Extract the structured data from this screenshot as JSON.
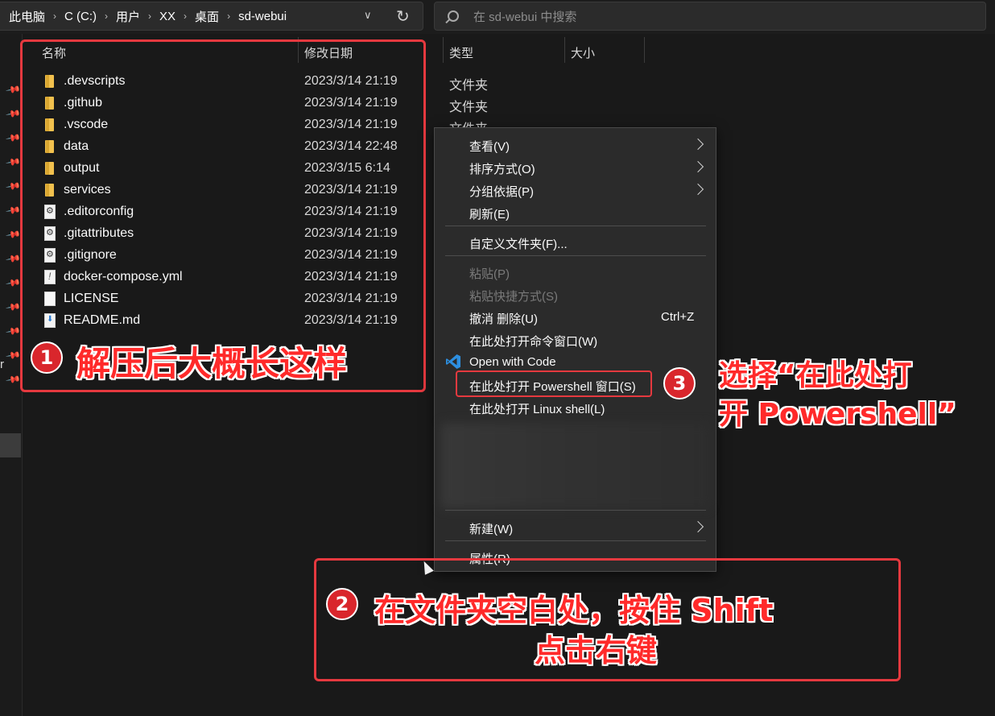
{
  "address_bar": {
    "crumbs": [
      "此电脑",
      "C (C:)",
      "用户",
      "XX",
      "桌面",
      "sd-webui"
    ],
    "separator": "›",
    "dropdown": "∨",
    "refresh": "↻"
  },
  "search": {
    "placeholder": "在 sd-webui 中搜索"
  },
  "columns": {
    "name": "名称",
    "date": "修改日期",
    "type": "类型",
    "size": "大小"
  },
  "nav_fragment": "r",
  "files": [
    {
      "name": ".devscripts",
      "date": "2023/3/14 21:19",
      "type": "文件夹",
      "icon": "folder-icon"
    },
    {
      "name": ".github",
      "date": "2023/3/14 21:19",
      "type": "文件夹",
      "icon": "folder-icon"
    },
    {
      "name": ".vscode",
      "date": "2023/3/14 21:19",
      "type": "文件夹",
      "icon": "folder-icon"
    },
    {
      "name": "data",
      "date": "2023/3/14 22:48",
      "type": "",
      "icon": "folder-icon"
    },
    {
      "name": "output",
      "date": "2023/3/15 6:14",
      "type": "",
      "icon": "folder-icon"
    },
    {
      "name": "services",
      "date": "2023/3/14 21:19",
      "type": "",
      "icon": "folder-icon"
    },
    {
      "name": ".editorconfig",
      "date": "2023/3/14 21:19",
      "type": "",
      "icon": "gear-file-icon"
    },
    {
      "name": ".gitattributes",
      "date": "2023/3/14 21:19",
      "type": "",
      "icon": "gear-file-icon"
    },
    {
      "name": ".gitignore",
      "date": "2023/3/14 21:19",
      "type": "",
      "icon": "gear-file-icon"
    },
    {
      "name": "docker-compose.yml",
      "date": "2023/3/14 21:19",
      "type": "",
      "icon": "yml-file-icon"
    },
    {
      "name": "LICENSE",
      "date": "2023/3/14 21:19",
      "type": "",
      "icon": "document-icon"
    },
    {
      "name": "README.md",
      "date": "2023/3/14 21:19",
      "type": "",
      "icon": "markdown-file-icon"
    }
  ],
  "context_menu": {
    "view": "查看(V)",
    "sort": "排序方式(O)",
    "group": "分组依据(P)",
    "refresh": "刷新(E)",
    "customize": "自定义文件夹(F)...",
    "paste": "粘贴(P)",
    "paste_shortcut": "粘贴快捷方式(S)",
    "undo_delete": "撤消 删除(U)",
    "undo_shortcut": "Ctrl+Z",
    "open_cmd": "在此处打开命令窗口(W)",
    "open_with_code": "Open with Code",
    "open_powershell": "在此处打开 Powershell 窗口(S)",
    "open_linux_shell": "在此处打开 Linux shell(L)",
    "new": "新建(W)",
    "properties": "属性(R)"
  },
  "annotations": {
    "step1_number": "1",
    "step1_text": "解压后大概长这样",
    "step2_number": "2",
    "step2_line1": "在文件夹空白处，按住 Shift",
    "step2_line2": "点击右键",
    "step3_number": "3",
    "step3_line1": "选择“在此处打",
    "step3_line2": "开 Powershell”"
  },
  "colors": {
    "annotation_red": "#e5393f",
    "annotation_text": "#ff2a2a",
    "folder": "#f2c14e",
    "menu_bg": "#2b2b2b",
    "window_bg": "#191919"
  }
}
